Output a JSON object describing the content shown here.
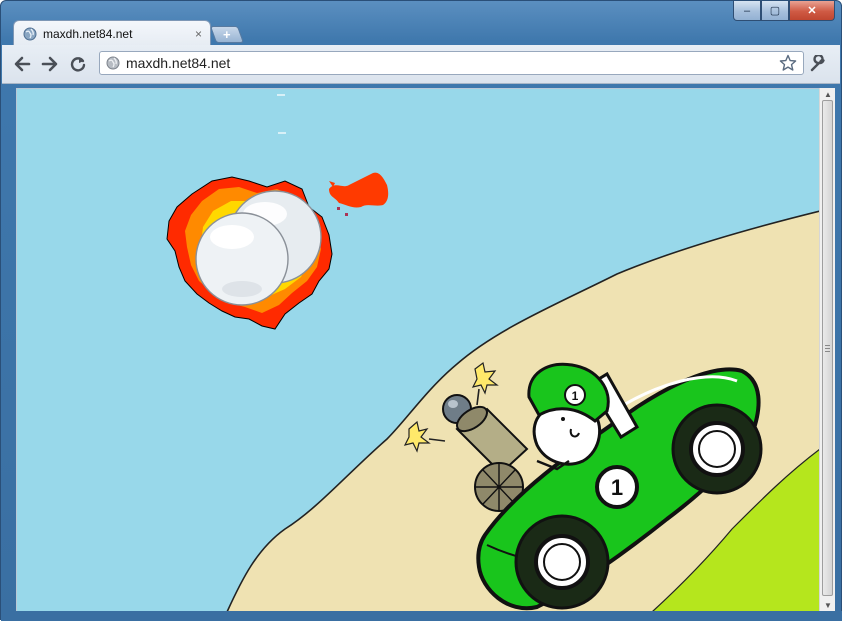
{
  "window": {
    "controls": {
      "minimize": "–",
      "maximize": "▢",
      "close": "✕"
    }
  },
  "tab": {
    "title": "maxdh.net84.net",
    "close_glyph": "×",
    "favicon": "globe-icon"
  },
  "new_tab": {
    "glyph": "+"
  },
  "toolbar": {
    "back_icon": "back-arrow-icon",
    "forward_icon": "forward-arrow-icon",
    "reload_icon": "reload-icon",
    "star_icon": "bookmark-star-icon",
    "wrench_icon": "wrench-icon"
  },
  "omnibox": {
    "url": "maxdh.net84.net"
  },
  "game": {
    "car_number": "1",
    "helmet_number": "1",
    "colors": {
      "sky": "#98d8ea",
      "sand": "#efe2b2",
      "grass": "#b5e61d",
      "car": "#19c51c",
      "explosion": "#ff3a00"
    }
  },
  "scrollbar": {
    "up": "▲",
    "down": "▼"
  }
}
